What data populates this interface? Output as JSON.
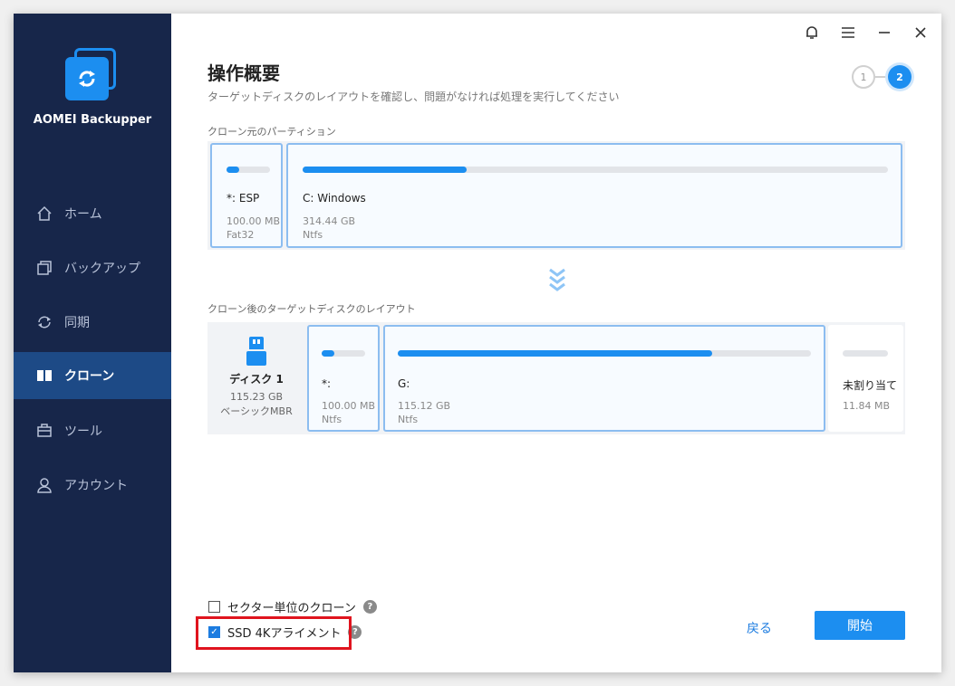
{
  "app": {
    "name": "AOMEI Backupper"
  },
  "sidebar": {
    "items": [
      {
        "label": "ホーム",
        "icon": "home-icon"
      },
      {
        "label": "バックアップ",
        "icon": "backup-icon"
      },
      {
        "label": "同期",
        "icon": "sync-icon"
      },
      {
        "label": "クローン",
        "icon": "clone-icon",
        "active": true
      },
      {
        "label": "ツール",
        "icon": "tools-icon"
      },
      {
        "label": "アカウント",
        "icon": "account-icon"
      }
    ]
  },
  "titlebar": {
    "icons": [
      "bell-icon",
      "menu-icon",
      "minimize-icon",
      "close-icon"
    ]
  },
  "header": {
    "title": "操作概要",
    "subtitle": "ターゲットディスクのレイアウトを確認し、問題がなければ処理を実行してください",
    "steps": [
      "1",
      "2"
    ],
    "current_step": 2
  },
  "source": {
    "label": "クローン元のパーティション",
    "partitions": [
      {
        "name": "*: ESP",
        "size": "100.00 MB",
        "fs": "Fat32",
        "used": 0.3
      },
      {
        "name": "C: Windows",
        "size": "314.44 GB",
        "fs": "Ntfs",
        "used": 0.28
      }
    ]
  },
  "target": {
    "label": "クローン後のターゲットディスクのレイアウト",
    "disk": {
      "name": "ディスク 1",
      "size": "115.23 GB",
      "type": "ベーシックMBR"
    },
    "partitions": [
      {
        "name": "*:",
        "size": "100.00 MB",
        "fs": "Ntfs",
        "used": 0.3
      },
      {
        "name": "G:",
        "size": "115.12 GB",
        "fs": "Ntfs",
        "used": 0.76
      },
      {
        "name": "未割り当て",
        "size": "11.84 MB",
        "fs": "",
        "used": 0
      }
    ]
  },
  "options": {
    "sector_clone": {
      "label": "セクター単位のクローン",
      "checked": false
    },
    "ssd_align": {
      "label": "SSD 4Kアライメント",
      "checked": true
    }
  },
  "buttons": {
    "back": "戻る",
    "start": "開始"
  },
  "colors": {
    "accent": "#1c8ef0",
    "sidebar": "#17264a",
    "highlight": "#e0141e"
  }
}
